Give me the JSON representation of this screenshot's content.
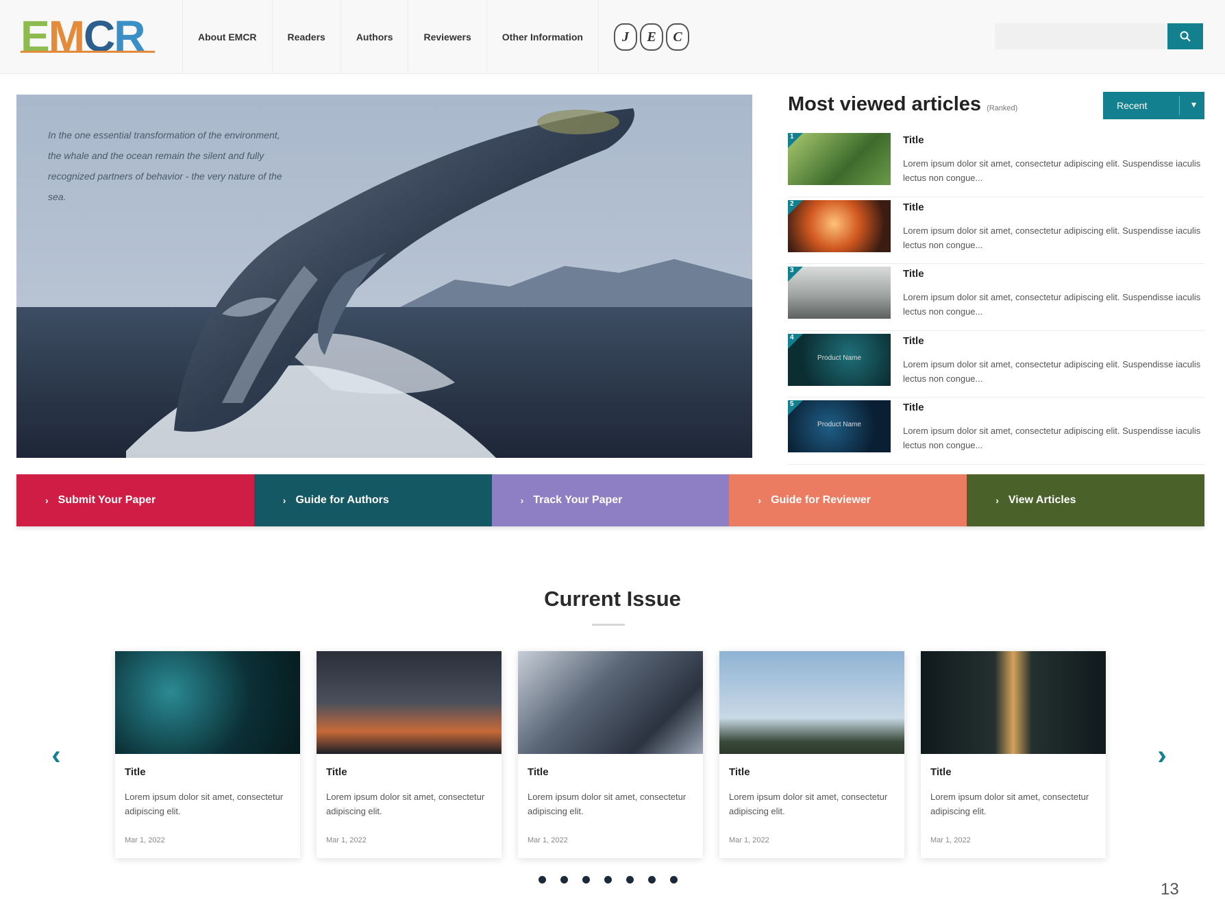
{
  "header": {
    "logo": {
      "letters": [
        "E",
        "M",
        "C",
        "R"
      ],
      "colors": [
        "#8dbb4f",
        "#e38b3a",
        "#2d5f8e",
        "#3a8fc7"
      ]
    },
    "nav": [
      "About EMCR",
      "Readers",
      "Authors",
      "Reviewers",
      "Other Information"
    ],
    "badges": [
      "J",
      "E",
      "C"
    ],
    "search": {
      "placeholder": "",
      "button_icon": "search-icon"
    }
  },
  "hero": {
    "caption": "In the one essential transformation of the environment, the whale and the ocean remain the silent and fully recognized partners of behavior - the very nature of the sea."
  },
  "most_viewed": {
    "title": "Most viewed articles",
    "subtitle": "(Ranked)",
    "select_value": "Recent",
    "items": [
      {
        "rank": "1",
        "title": "Title",
        "text": "Lorem ipsum dolor sit amet, consectetur adipiscing elit. Suspendisse iaculis lectus non congue...",
        "thumb": "#5e8a3e",
        "thumb_label": ""
      },
      {
        "rank": "2",
        "title": "Title",
        "text": "Lorem ipsum dolor sit amet, consectetur adipiscing elit. Suspendisse iaculis lectus non congue...",
        "thumb": "#c8561e",
        "thumb_label": ""
      },
      {
        "rank": "3",
        "title": "Title",
        "text": "Lorem ipsum dolor sit amet, consectetur adipiscing elit. Suspendisse iaculis lectus non congue...",
        "thumb": "#9a9d9c",
        "thumb_label": ""
      },
      {
        "rank": "4",
        "title": "Title",
        "text": "Lorem ipsum dolor sit amet, consectetur adipiscing elit. Suspendisse iaculis lectus non congue...",
        "thumb": "#0e3a40",
        "thumb_label": "Product Name"
      },
      {
        "rank": "5",
        "title": "Title",
        "text": "Lorem ipsum dolor sit amet, consectetur adipiscing elit. Suspendisse iaculis lectus non congue...",
        "thumb": "#0b2b45",
        "thumb_label": "Product Name"
      }
    ]
  },
  "actions": [
    {
      "label": "Submit Your Paper",
      "color": "#cf1d45"
    },
    {
      "label": "Guide for Authors",
      "color": "#135862"
    },
    {
      "label": "Track Your Paper",
      "color": "#8e7ec4"
    },
    {
      "label": "Guide for Reviewer",
      "color": "#ec7c61"
    },
    {
      "label": "View Articles",
      "color": "#4a6229"
    }
  ],
  "current_issue": {
    "title": "Current Issue",
    "cards": [
      {
        "title": "Title",
        "text": "Lorem ipsum dolor sit amet, consectetur adipiscing elit.",
        "date": "Mar 1, 2022"
      },
      {
        "title": "Title",
        "text": "Lorem ipsum dolor sit amet, consectetur adipiscing elit.",
        "date": "Mar 1, 2022"
      },
      {
        "title": "Title",
        "text": "Lorem ipsum dolor sit amet, consectetur adipiscing elit.",
        "date": "Mar 1, 2022"
      },
      {
        "title": "Title",
        "text": "Lorem ipsum dolor sit amet, consectetur adipiscing elit.",
        "date": "Mar 1, 2022"
      },
      {
        "title": "Title",
        "text": "Lorem ipsum dolor sit amet, consectetur adipiscing elit.",
        "date": "Mar 1, 2022"
      }
    ],
    "dots_count": 7,
    "prev_icon": "chevron-left-icon",
    "next_icon": "chevron-right-icon"
  },
  "page_number": "13"
}
